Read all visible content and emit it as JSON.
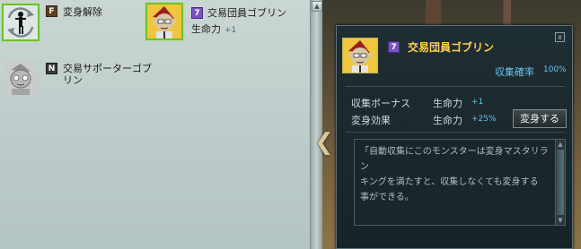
{
  "list": {
    "items": [
      {
        "rank": "F",
        "name": "変身解除",
        "icon": "transform-icon"
      },
      {
        "rank": "7",
        "name": "交易団員ゴブリン",
        "stat_label": "生命力",
        "stat_value": "+1",
        "icon": "goblin-portrait"
      },
      {
        "rank": "N",
        "name_line1": "交易サポーターゴブ",
        "name_line2": "リン",
        "icon": "goblin-portrait-gray"
      }
    ]
  },
  "detail": {
    "rank": "7",
    "name": "交易団員ゴブリン",
    "collect_rate_label": "収集確率",
    "collect_rate_value": "100%",
    "bonus_label": "収集ボーナス",
    "bonus_stat": "生命力",
    "bonus_value": "+1",
    "effect_label": "変身効果",
    "effect_stat": "生命力",
    "effect_value": "+25%",
    "transform_button": "変身する",
    "close_label": "x",
    "description_lines": [
      "「自動収集にこのモンスターは変身マスタリラン",
      "キングを満たすと、収集しなくても変身する",
      "事ができる。"
    ]
  },
  "colors": {
    "selected_border": "#6dc22a",
    "name_gold": "#ffd24a",
    "value_cyan": "#62c3ee",
    "rank7_purple": "#7a52c2"
  }
}
